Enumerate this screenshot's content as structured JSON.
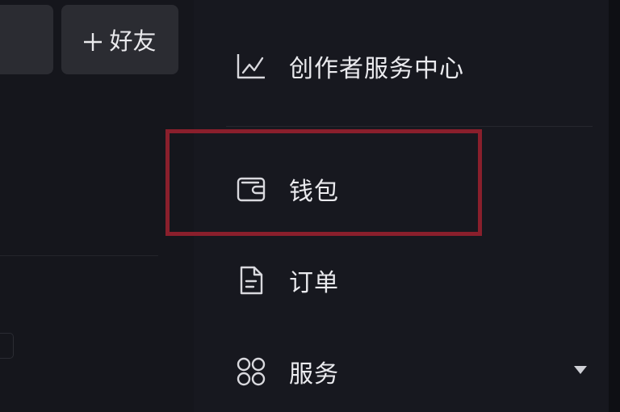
{
  "left_panel": {
    "add_friend_label": "好友"
  },
  "menu": {
    "items": [
      {
        "label": "创作者服务中心",
        "icon": "trend-chart-icon"
      },
      {
        "label": "钱包",
        "icon": "wallet-icon"
      },
      {
        "label": "订单",
        "icon": "document-icon"
      },
      {
        "label": "服务",
        "icon": "grid-icon"
      }
    ]
  },
  "colors": {
    "background": "#17181f",
    "text": "#eaeaee",
    "highlight": "#8a1f2c",
    "button_bg": "#2b2c32"
  }
}
